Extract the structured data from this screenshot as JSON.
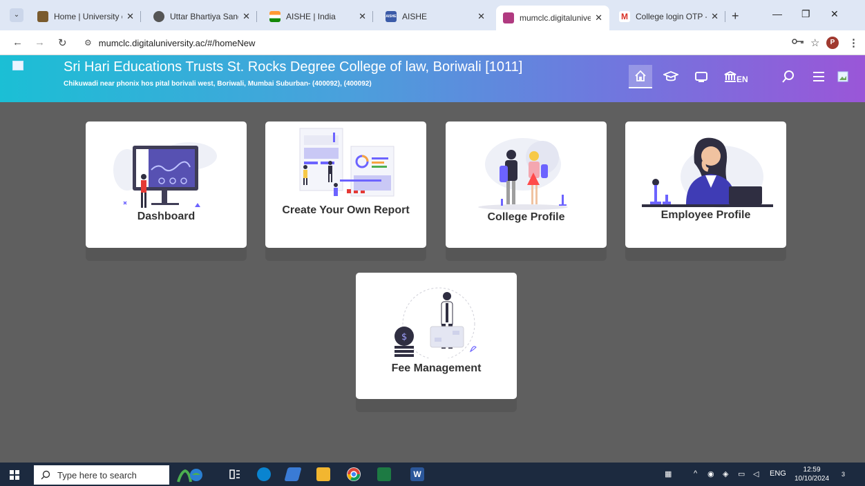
{
  "browser": {
    "tabs": [
      {
        "title": "Home | University of",
        "favicon_color": "#7a5b2e"
      },
      {
        "title": "Uttar Bhartiya Sangh",
        "favicon_color": "#555555"
      },
      {
        "title": "AISHE | India",
        "favicon_color": "#e86f2c"
      },
      {
        "title": "AISHE",
        "favicon_color": "#3b5ba8",
        "favicon_text": "AISHE"
      },
      {
        "title": "mumclc.digitaluniver",
        "favicon_color": "#b03a80",
        "active": true
      },
      {
        "title": "College login OTP - s",
        "favicon_color": "#d93025",
        "favicon_text": "M"
      }
    ],
    "url": "mumclc.digitaluniversity.ac/#/homeNew",
    "profile_initial": "P"
  },
  "header": {
    "college_name": "Sri Hari Educations Trusts St. Rocks Degree College of law, Boriwali [1011]",
    "college_address": "Chikuwadi near phonix hos pital borivali west, Boriwali, Mumbai Suburban- (400092), (400092)",
    "language": "EN",
    "icons": [
      "home-icon",
      "graduation-cap-icon",
      "monitor-icon",
      "institution-icon",
      "search-icon",
      "menu-icon",
      "avatar"
    ]
  },
  "cards": [
    {
      "label": "Dashboard"
    },
    {
      "label": "Create Your Own Report"
    },
    {
      "label": "College Profile"
    },
    {
      "label": "Employee Profile"
    },
    {
      "label": "Fee Management"
    }
  ],
  "taskbar": {
    "search_placeholder": "Type here to search",
    "language": "ENG",
    "time": "12:59",
    "date": "10/10/2024",
    "notification_count": "3"
  },
  "colors": {
    "header_gradient_start": "#1bbfd5",
    "header_gradient_end": "#9a56d8",
    "accent_purple": "#4b4ab8",
    "page_background": "#5f5f5f"
  }
}
